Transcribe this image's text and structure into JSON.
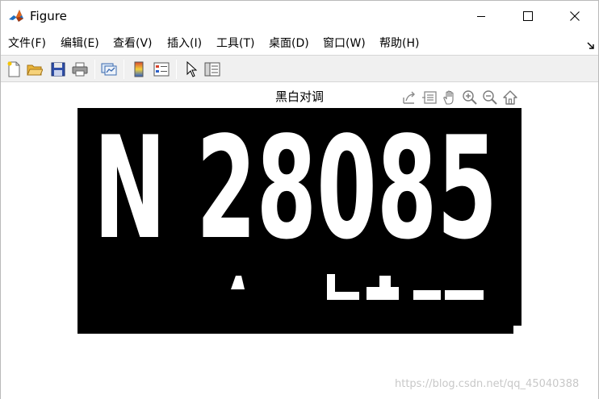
{
  "window": {
    "title": "Figure",
    "icon": "matlab-icon",
    "controls": {
      "minimize": "minimize-icon",
      "maximize": "maximize-icon",
      "close": "close-icon"
    }
  },
  "menu": {
    "items": [
      {
        "label": "文件(F)"
      },
      {
        "label": "编辑(E)"
      },
      {
        "label": "查看(V)"
      },
      {
        "label": "插入(I)"
      },
      {
        "label": "工具(T)"
      },
      {
        "label": "桌面(D)"
      },
      {
        "label": "窗口(W)"
      },
      {
        "label": "帮助(H)"
      }
    ],
    "overflow_icon": "dock-arrow-icon"
  },
  "toolbar": {
    "buttons": [
      "new-figure-icon",
      "open-file-icon",
      "save-icon",
      "print-icon",
      "link-plot-icon",
      "colorbar-icon",
      "legend-icon",
      "pointer-icon",
      "property-inspector-icon"
    ]
  },
  "axes": {
    "title": "黑白对调",
    "tools": [
      "export-icon",
      "brush-icon",
      "pan-icon",
      "zoom-in-icon",
      "zoom-out-icon",
      "home-icon"
    ]
  },
  "image": {
    "plate_text": "N 28085",
    "foreground": "#ffffff",
    "background": "#000000"
  },
  "watermark": "https://blog.csdn.net/qq_45040388"
}
